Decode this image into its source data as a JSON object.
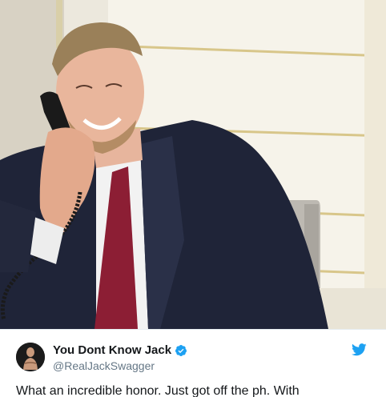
{
  "tweet": {
    "display_name": "You Dont Know Jack",
    "handle": "@RealJackSwagger",
    "text": "What an incredible honor. Just got off the ph. With",
    "verified": true
  },
  "media": {
    "photo_icon": "person-on-phone-photo"
  },
  "colors": {
    "brand_blue": "#1da1f2",
    "text_primary": "#14171a",
    "text_secondary": "#657786"
  }
}
